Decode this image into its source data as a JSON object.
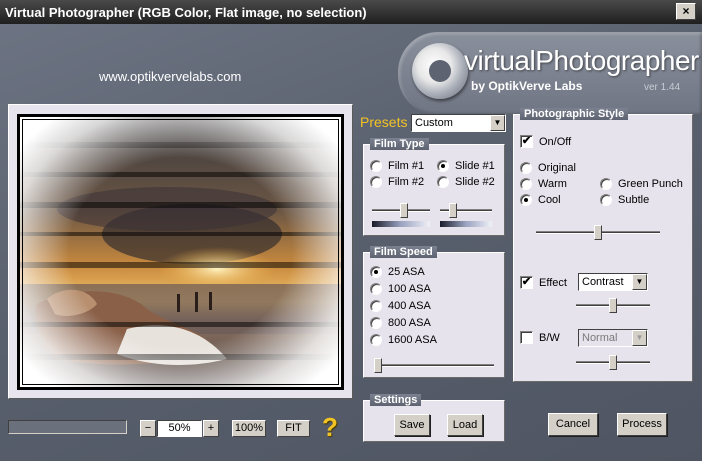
{
  "window": {
    "title": "Virtual Photographer (RGB Color, Flat image, no selection)",
    "close_glyph": "×"
  },
  "website": "www.optikvervelabs.com",
  "logo": {
    "name": "virtualPhotographer",
    "byline": "by OptikVerve Labs",
    "version": "ver 1.44"
  },
  "preview": {
    "zoom_value": "50%",
    "zoom_minus": "−",
    "zoom_plus": "+",
    "zoom_100": "100%",
    "zoom_fit": "FIT",
    "help_glyph": "?"
  },
  "presets": {
    "label": "Presets",
    "value": "Custom"
  },
  "film_type": {
    "title": "Film Type",
    "options": [
      {
        "label": "Film #1",
        "selected": false
      },
      {
        "label": "Slide #1",
        "selected": true
      },
      {
        "label": "Film #2",
        "selected": false
      },
      {
        "label": "Slide #2",
        "selected": false
      }
    ],
    "slider_left_level": 0.55,
    "slider_right_level": 0.2
  },
  "film_speed": {
    "title": "Film Speed",
    "options": [
      {
        "label": "25 ASA",
        "selected": true
      },
      {
        "label": "100 ASA",
        "selected": false
      },
      {
        "label": "400 ASA",
        "selected": false
      },
      {
        "label": "800 ASA",
        "selected": false
      },
      {
        "label": "1600 ASA",
        "selected": false
      }
    ],
    "slider_level": 0.0
  },
  "settings": {
    "title": "Settings",
    "save_label": "Save",
    "load_label": "Load"
  },
  "photographic_style": {
    "title": "Photographic Style",
    "onoff_label": "On/Off",
    "onoff_checked": true,
    "options": [
      {
        "label": "Original",
        "selected": false
      },
      {
        "label": "Warm",
        "selected": false
      },
      {
        "label": "Green Punch",
        "selected": false
      },
      {
        "label": "Cool",
        "selected": true
      },
      {
        "label": "Subtle",
        "selected": false
      }
    ],
    "style_slider_level": 0.5,
    "effect_label": "Effect",
    "effect_checked": true,
    "effect_value": "Contrast",
    "effect_slider_level": 0.5,
    "bw_label": "B/W",
    "bw_checked": false,
    "bw_value": "Normal",
    "bw_slider_level": 0.5
  },
  "buttons": {
    "cancel_label": "Cancel",
    "process_label": "Process"
  },
  "colors": {
    "accent": "#f3c324",
    "panel_bg": "#e6e3ec",
    "window_bg": "#5f6572"
  }
}
